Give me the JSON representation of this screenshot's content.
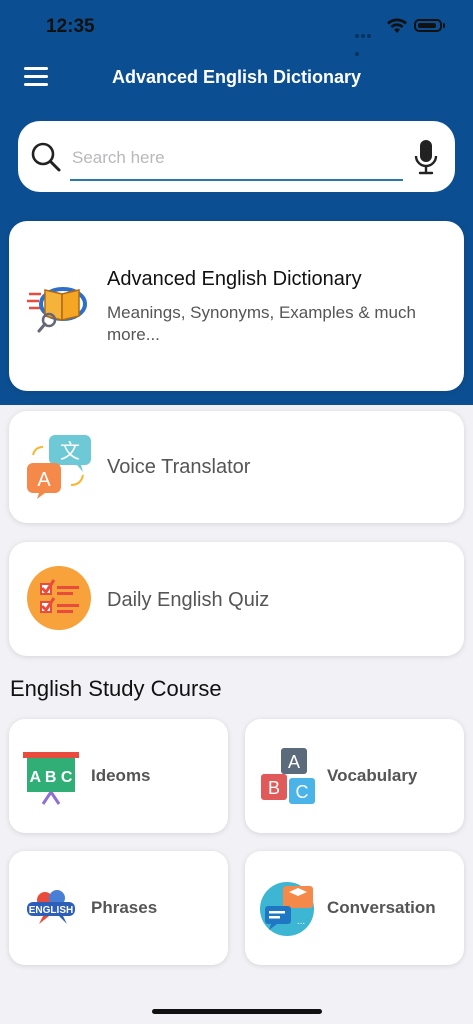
{
  "status_bar": {
    "time": "12:35"
  },
  "header": {
    "title": "Advanced English Dictionary",
    "background": "#0b4f92"
  },
  "search": {
    "placeholder": "Search here",
    "value": ""
  },
  "cards": {
    "dictionary": {
      "title": "Advanced English Dictionary",
      "subtitle": "Meanings, Synonyms, Examples & much more...",
      "icon": "dictionary-book-icon"
    },
    "voice": {
      "label": "Voice Translator",
      "icon": "translate-bubbles-icon"
    },
    "quiz": {
      "label": "Daily English Quiz",
      "icon": "quiz-checklist-icon"
    }
  },
  "study_course": {
    "title": "English Study Course",
    "tiles": [
      {
        "label": "Ideoms",
        "icon": "abc-board-icon"
      },
      {
        "label": "Vocabulary",
        "icon": "abc-blocks-icon"
      },
      {
        "label": "Phrases",
        "icon": "english-bubble-icon"
      },
      {
        "label": "Conversation",
        "icon": "chat-screens-icon"
      }
    ]
  }
}
